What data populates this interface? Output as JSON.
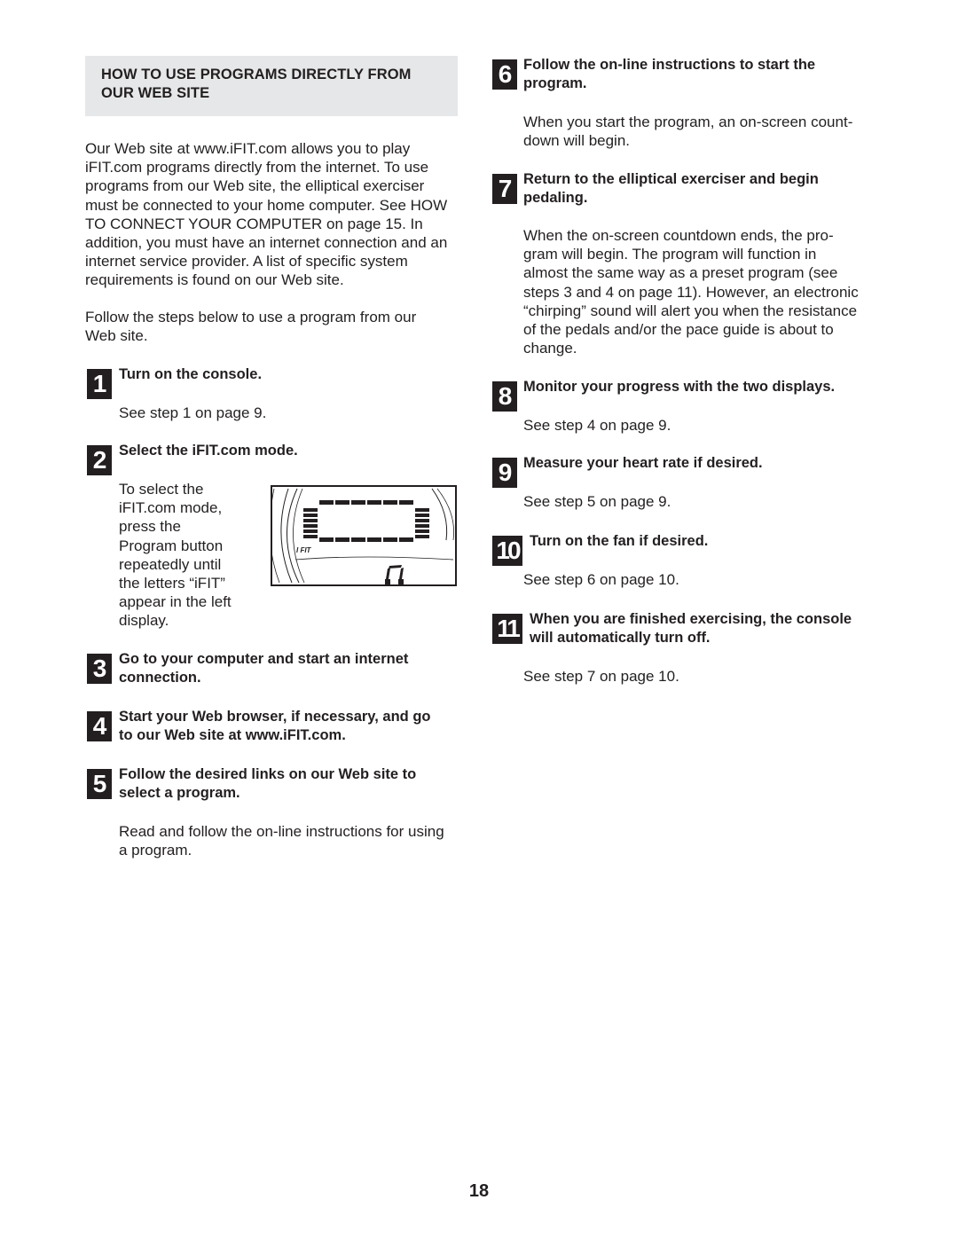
{
  "section": {
    "heading": "HOW TO USE PROGRAMS DIRECTLY FROM OUR WEB SITE",
    "heading_line1": "HOW TO USE PROGRAMS DIRECTLY FROM",
    "heading_line2": "OUR WEB SITE",
    "intro_lines": [
      "Our Web site at www.iFIT.com allows you to play",
      "iFIT.com programs directly from the internet. To use",
      "programs from our Web site, the elliptical exerciser",
      "must be connected to your home computer. See HOW",
      "TO CONNECT YOUR COMPUTER on page 15. In",
      "addition, you must have an internet connection and an",
      "internet service provider. A list of specific system",
      "requirements is found on our Web site."
    ],
    "follow_lines": [
      "Follow the steps below to use a program from our",
      "Web site."
    ]
  },
  "steps": [
    {
      "number": "1",
      "title_lines": [
        "Turn on the console."
      ],
      "body_lines": [
        "See step 1 on page 9."
      ]
    },
    {
      "number": "2",
      "title_lines": [
        "Select the iFIT.com mode."
      ],
      "body_lines": [
        "To select the",
        "iFIT.com mode,",
        "press the",
        "Program button",
        "repeatedly until",
        "the letters “iFIT”",
        "appear in the left",
        "display."
      ]
    },
    {
      "number": "3",
      "title_lines": [
        "Go to your computer and start an internet",
        "connection."
      ],
      "body_lines": []
    },
    {
      "number": "4",
      "title_lines": [
        "Start your Web browser, if necessary, and go",
        "to our Web site at www.iFIT.com."
      ],
      "body_lines": []
    },
    {
      "number": "5",
      "title_lines": [
        "Follow the desired links on our Web site to",
        "select a program."
      ],
      "body_lines": [
        "Read and follow the on-line instructions for using",
        "a program."
      ]
    },
    {
      "number": "6",
      "title_lines": [
        "Follow the on-line instructions to start the",
        "program."
      ],
      "body_lines": [
        "When you start the program, an on-screen count-",
        "down will begin."
      ]
    },
    {
      "number": "7",
      "title_lines": [
        "Return to the elliptical exerciser and begin",
        "pedaling."
      ],
      "body_lines": [
        "When the on-screen countdown ends, the pro-",
        "gram will begin. The program will function in",
        "almost the same way as a preset program (see",
        "steps 3 and 4 on page 11). However, an electronic",
        "“chirping” sound will alert you when the resistance",
        "of the pedals and/or the pace guide is about to",
        "change."
      ]
    },
    {
      "number": "8",
      "title_lines": [
        "Monitor your progress with the two displays."
      ],
      "body_lines": [
        "See step 4 on page 9."
      ]
    },
    {
      "number": "9",
      "title_lines": [
        "Measure your heart rate if desired."
      ],
      "body_lines": [
        "See step 5 on page 9."
      ]
    },
    {
      "number": "10",
      "title_lines": [
        "Turn on the fan if desired."
      ],
      "body_lines": [
        "See step 6 on page 10."
      ]
    },
    {
      "number": "11",
      "title_lines": [
        "When you are finished exercising, the console",
        "will automatically turn off."
      ],
      "body_lines": [
        "See step 7 on page 10."
      ]
    }
  ],
  "display_illustration": {
    "label": "I FIT",
    "icon": "console-lcd-display"
  },
  "page_number": "18"
}
